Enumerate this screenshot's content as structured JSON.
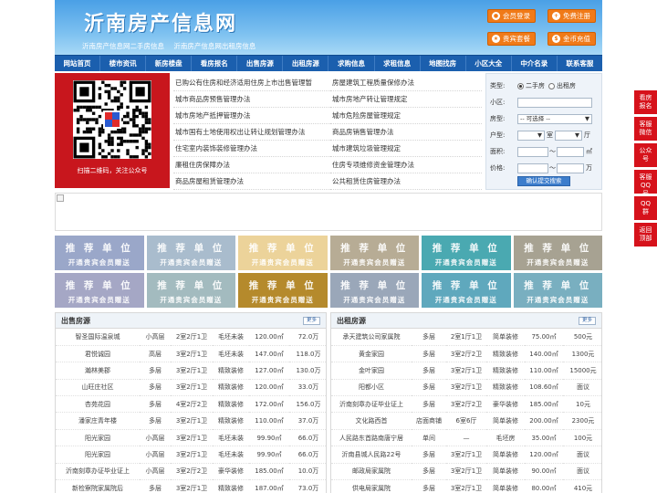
{
  "header": {
    "logo": "沂南房产信息网",
    "tagline": [
      "沂南房产信息网二手房信息",
      "沂南房产信息网出租房信息"
    ],
    "buttons": [
      {
        "label": "会员登录",
        "icon": "user-icon"
      },
      {
        "label": "免费注册",
        "icon": "register-icon"
      },
      {
        "label": "贵宾套餐",
        "icon": "vip-icon"
      },
      {
        "label": "金币充值",
        "icon": "coin-icon"
      }
    ]
  },
  "nav": [
    "网站首页",
    "楼市资讯",
    "新房楼盘",
    "看房报名",
    "出售房源",
    "出租房源",
    "求购信息",
    "求租信息",
    "地图找房",
    "小区大全",
    "中介名录",
    "联系客服"
  ],
  "qr": {
    "caption": "扫描二维码，关注公众号"
  },
  "links": [
    "已购公有住房和经济适用住房上市出售管理暂",
    "房屋建筑工程质量保修办法",
    "城市商品房预售管理办法",
    "城市房地产转让管理规定",
    "城市房地产抵押管理办法",
    "城市危险房屋管理规定",
    "城市国有土地使用权出让转让规划管理办法",
    "商品房销售管理办法",
    "住宅室内装饰装修管理办法",
    "城市建筑垃圾管理规定",
    "廉租住房保障办法",
    "住房专项维修资金管理办法",
    "商品房屋租赁管理办法",
    "公共租赁住房管理办法"
  ],
  "search": {
    "type_label": "类型:",
    "type_options": [
      "二手房",
      "出租房"
    ],
    "type_selected": "二手房",
    "community_label": "小区:",
    "community_value": "",
    "housetype_label": "房型:",
    "housetype_selected": "-- 可选择 --",
    "layout_label": "户型:",
    "room_unit": "室",
    "hall_unit": "厅",
    "area_label": "面积:",
    "area_sep": "～",
    "area_unit": "㎡",
    "price_label": "价格:",
    "price_sep": "～",
    "price_unit": "万",
    "submit": "确认提交搜索"
  },
  "ads": {
    "title": "推 荐 单 位",
    "sub": "开通贵宾会员赠送",
    "colors": [
      "#9aa7c9",
      "#a9bccd",
      "#ecd39a",
      "#b7ac95",
      "#4aa9b1",
      "#a7a292",
      "#a5a7c5",
      "#a3bbbf",
      "#b58a2c",
      "#9aa7b9",
      "#5fa8bd",
      "#79afc0"
    ]
  },
  "sale": {
    "title": "出售房源",
    "more": "更多",
    "rows": [
      [
        "智圣国际温泉城",
        "小高层",
        "2室2厅1卫",
        "毛坯未装",
        "120.00㎡",
        "72.0万"
      ],
      [
        "君悦诚园",
        "高层",
        "3室2厅1卫",
        "毛坯未装",
        "147.00㎡",
        "118.0万"
      ],
      [
        "瀚林美郡",
        "多层",
        "3室2厅1卫",
        "精致装修",
        "127.00㎡",
        "130.0万"
      ],
      [
        "山旺庄社区",
        "多层",
        "3室2厅1卫",
        "精致装修",
        "120.00㎡",
        "33.0万"
      ],
      [
        "杏苑花园",
        "多层",
        "4室2厅2卫",
        "精致装修",
        "172.00㎡",
        "156.0万"
      ],
      [
        "潘家庄青年楼",
        "多层",
        "3室2厅1卫",
        "精致装修",
        "110.00㎡",
        "37.0万"
      ],
      [
        "阳光家园",
        "小高层",
        "3室2厅1卫",
        "毛坯未装",
        "99.90㎡",
        "66.0万"
      ],
      [
        "阳光家园",
        "小高层",
        "3室2厅1卫",
        "毛坯未装",
        "99.90㎡",
        "66.0万"
      ],
      [
        "沂南刻章办证毕业证上",
        "小高层",
        "3室2厅2卫",
        "豪华装修",
        "185.00㎡",
        "10.0万"
      ],
      [
        "新检察院家属院后",
        "多层",
        "3室2厅1卫",
        "精致装修",
        "187.00㎡",
        "73.0万"
      ]
    ]
  },
  "rent": {
    "title": "出租房源",
    "more": "更多",
    "rows": [
      [
        "承天建筑公司家属院",
        "多层",
        "2室1厅1卫",
        "简单装修",
        "75.00㎡",
        "500元"
      ],
      [
        "黄金家园",
        "多层",
        "3室2厅2卫",
        "精致装修",
        "140.00㎡",
        "1300元"
      ],
      [
        "金叶家园",
        "多层",
        "3室2厅1卫",
        "精致装修",
        "110.00㎡",
        "15000元"
      ],
      [
        "阳都小区",
        "多层",
        "3室2厅1卫",
        "精致装修",
        "108.60㎡",
        "面议"
      ],
      [
        "沂南刻章办证毕业证上",
        "多层",
        "3室2厅2卫",
        "豪华装修",
        "185.00㎡",
        "10元"
      ],
      [
        "文化路西首",
        "店面商铺",
        "6室6厅",
        "简单装修",
        "200.00㎡",
        "2300元"
      ],
      [
        "人民路东首路南唐宁居",
        "单间",
        "—",
        "毛坯房",
        "35.00㎡",
        "100元"
      ],
      [
        "沂南县城人民路22号",
        "多层",
        "3室2厅1卫",
        "简单装修",
        "120.00㎡",
        "面议"
      ],
      [
        "邮政局家属院",
        "多层",
        "3室2厅1卫",
        "简单装修",
        "90.00㎡",
        "面议"
      ],
      [
        "供电局家属院",
        "多层",
        "3室2厅1卫",
        "简单装修",
        "80.00㎡",
        "410元"
      ]
    ]
  },
  "side": [
    "看房报名",
    "客服微信",
    "公众号",
    "客服QQ号",
    "QQ群",
    "返回顶部"
  ]
}
